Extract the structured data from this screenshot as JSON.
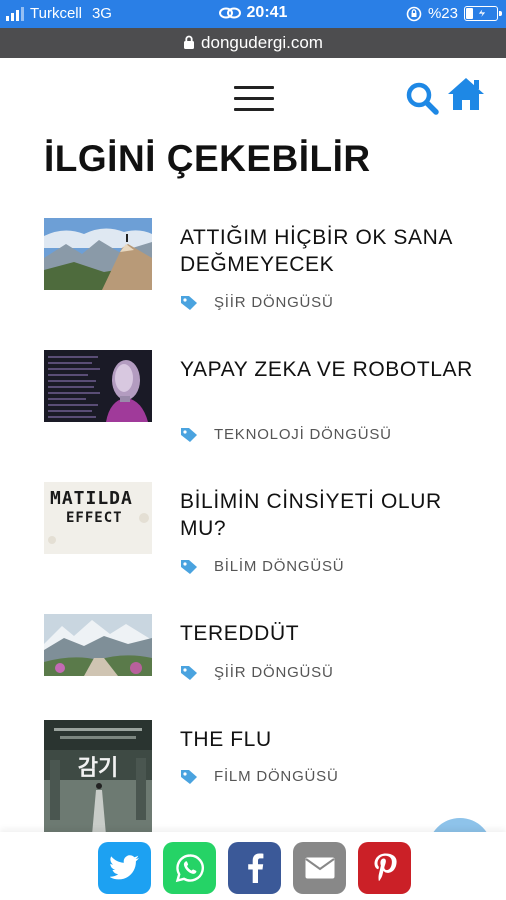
{
  "status_bar": {
    "carrier": "Turkcell",
    "network": "3G",
    "time": "20:41",
    "battery": "%23",
    "battery_fraction": 0.23
  },
  "url_bar": {
    "domain": "dongudergi.com"
  },
  "header": {
    "menu_icon": "hamburger-icon",
    "search_icon": "search-icon",
    "home_icon": "home-icon"
  },
  "section": {
    "title": "İLGİNİ ÇEKEBİLİR"
  },
  "articles": [
    {
      "title": "ATTIĞIM HİÇBİR OK SANA DEĞMEYECEK",
      "category": "ŞİİR DÖNGÜSÜ"
    },
    {
      "title": "YAPAY ZEKA VE ROBOTLAR",
      "category": "TEKNOLOJİ DÖNGÜSÜ"
    },
    {
      "title": "BİLİMİN CİNSİYETİ OLUR MU?",
      "category": "BİLİM DÖNGÜSÜ",
      "thumb_text_1": "MATILDA",
      "thumb_text_2": "EFFECT"
    },
    {
      "title": "TEREDDÜT",
      "category": "ŞİİR DÖNGÜSÜ"
    },
    {
      "title": "THE FLU",
      "category": "FİLM DÖNGÜSÜ",
      "thumb_text": "감기"
    }
  ],
  "share": [
    {
      "name": "twitter",
      "icon": "twitter-icon",
      "color": "#1da1f2"
    },
    {
      "name": "whatsapp",
      "icon": "whatsapp-icon",
      "color": "#25d366"
    },
    {
      "name": "facebook",
      "icon": "facebook-icon",
      "color": "#3b5998"
    },
    {
      "name": "email",
      "icon": "email-icon",
      "color": "#888888"
    },
    {
      "name": "pinterest",
      "icon": "pinterest-icon",
      "color": "#cb2027"
    }
  ],
  "colors": {
    "status_bar": "#2a7fe6",
    "url_bar": "#4d4d4f",
    "accent": "#1e88e5",
    "tag": "#4aa3df"
  }
}
